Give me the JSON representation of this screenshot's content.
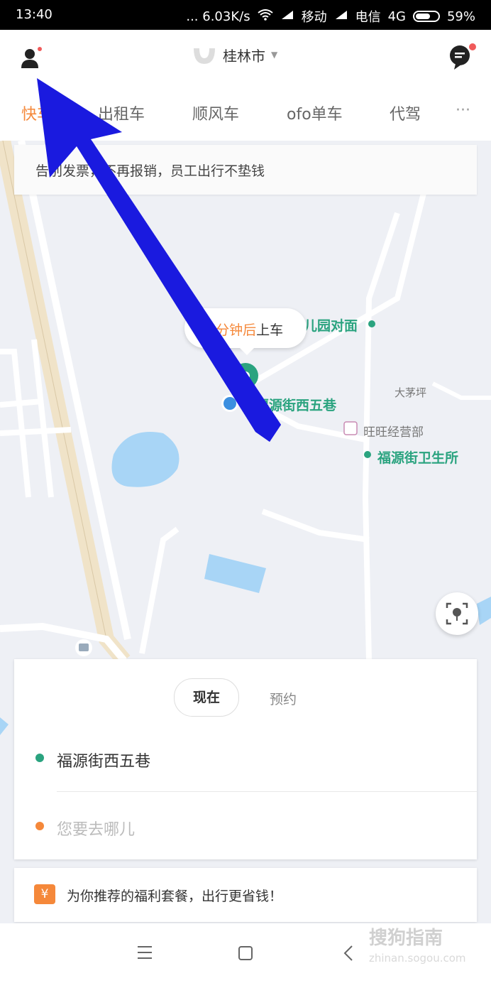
{
  "status_bar": {
    "time": "13:40",
    "speed": "... 6.03K/s",
    "carrier1": "移动",
    "carrier2": "电信",
    "network": "4G",
    "battery": "59%"
  },
  "header": {
    "city": "桂林市"
  },
  "tabs": [
    {
      "label": "快车",
      "active": true
    },
    {
      "label": "出租车"
    },
    {
      "label": "顺风车"
    },
    {
      "label": "ofo单车"
    },
    {
      "label": "代驾"
    },
    {
      "label": "···"
    }
  ],
  "banner": {
    "text": "告别发票，不再报销，员工出行不垫钱"
  },
  "map": {
    "bubble_orange": "1分钟后",
    "bubble_dark": "上车",
    "poi_kindergarten": "儿园对面",
    "poi_current": "福源街西五巷",
    "poi_village": "大茅坪",
    "poi_shop": "旺旺经营部",
    "poi_clinic": "福源街卫生所"
  },
  "card": {
    "now_label": "现在",
    "book_label": "预约",
    "from": "福源街西五巷",
    "to_placeholder": "您要去哪儿"
  },
  "promo": {
    "icon": "¥",
    "text": "为你推荐的福利套餐，出行更省钱！"
  },
  "watermark": {
    "text": "搜狗指南",
    "url": "zhinan.sogou.com"
  },
  "colors": {
    "accent_orange": "#f5883a",
    "poi_green": "#2aa37f",
    "arrow_blue": "#1a1adf"
  }
}
